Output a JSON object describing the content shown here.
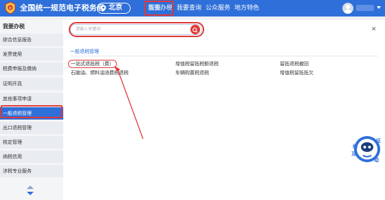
{
  "header": {
    "app_title": "全国统一规范电子税务局",
    "region": "北京",
    "nav": [
      {
        "label": "首页"
      },
      {
        "label": "我要办税"
      },
      {
        "label": "我要查询"
      },
      {
        "label": "公众服务"
      },
      {
        "label": "地方特色"
      }
    ],
    "active_nav": "我要办税"
  },
  "sidebar": {
    "title": "我要办税",
    "items": [
      {
        "label": "综合信息报告"
      },
      {
        "label": "发票使用"
      },
      {
        "label": "税费申报及缴纳"
      },
      {
        "label": "证明开具"
      },
      {
        "label": "其他事项申请"
      },
      {
        "label": "一般退税管理"
      },
      {
        "label": "出口退税管理"
      },
      {
        "label": "核定管理"
      },
      {
        "label": "纳税信用"
      },
      {
        "label": "涉税专业服务"
      }
    ],
    "active_item": "一般退税管理"
  },
  "main": {
    "search": {
      "placeholder": "请输入关键词"
    },
    "section_title": "一般退税管理",
    "links": [
      {
        "label": "一站式退抵税（费）"
      },
      {
        "label": "增值税留抵税额退税"
      },
      {
        "label": "留抵退税撤回"
      },
      {
        "label": "石脑油、燃料油消费税退税"
      },
      {
        "label": "车辆购置税退税"
      },
      {
        "label": "增值税留抵抵欠"
      }
    ]
  },
  "assistant": {
    "label": "征纳互动"
  },
  "colors": {
    "brand": "#2f6fd9",
    "highlight": "#e03838",
    "sidebar_bg": "#e9ecf1"
  }
}
